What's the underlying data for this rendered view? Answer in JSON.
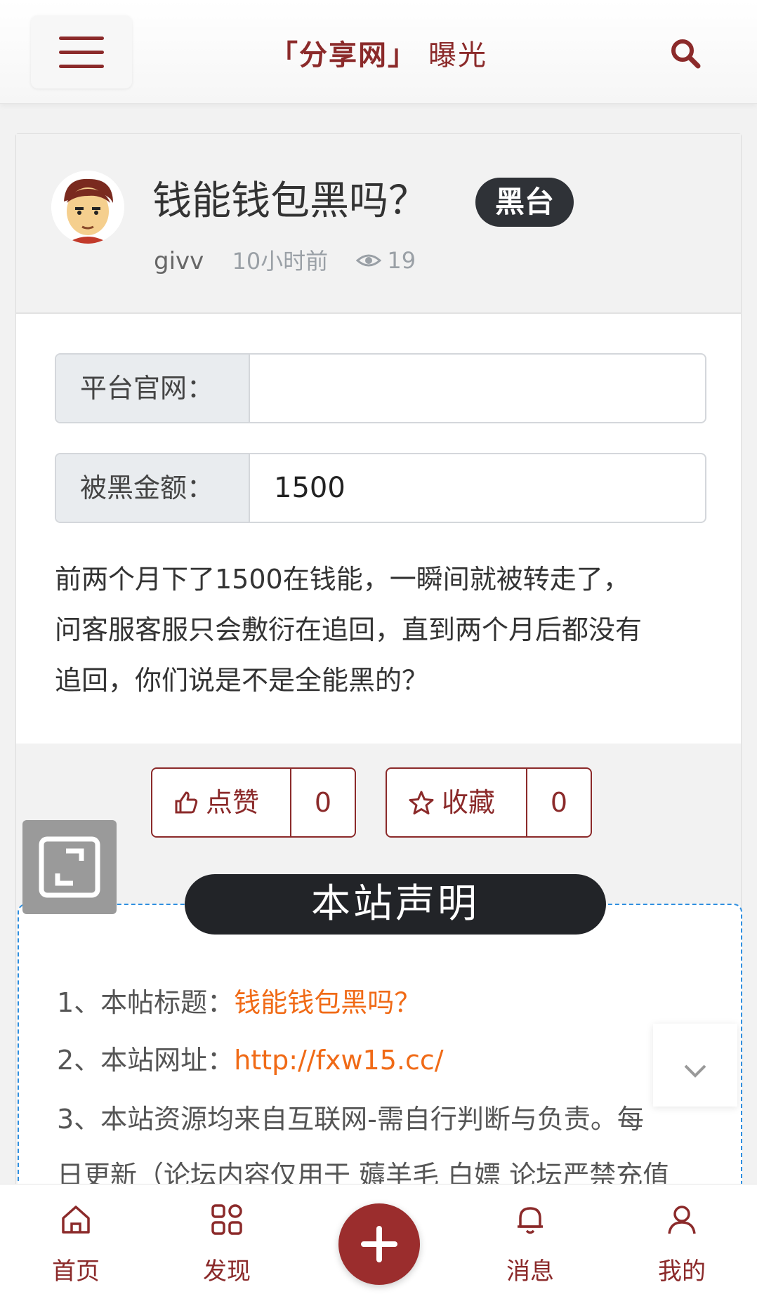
{
  "header": {
    "brand": "「分享网」",
    "subtitle": "曝光"
  },
  "post": {
    "title": "钱能钱包黑吗？",
    "tag": "黑台",
    "author": "givv",
    "time": "10小时前",
    "views": "19",
    "fields": [
      {
        "label": "平台官网：",
        "value": ""
      },
      {
        "label": "被黑金额：",
        "value": "1500"
      }
    ],
    "content_lines": [
      "前两个月下了1500在钱能，一瞬间就被转走了，",
      "问客服客服只会敷衍在追回，直到两个月后都没有",
      "追回，你们说是不是全能黑的？"
    ]
  },
  "actions": {
    "like_label": "点赞",
    "like_count": "0",
    "fav_label": "收藏",
    "fav_count": "0"
  },
  "notice": {
    "title": "本站声明",
    "line1_prefix": "1、本帖标题：",
    "line1_value": "钱能钱包黑吗？",
    "line2_prefix": "2、本站网址：",
    "line2_value": "http://fxw15.cc/",
    "line3": "3、本站资源均来自互联网-需自行判断与负责。每",
    "line4": "日更新（论坛内容仅用于 薅羊毛 白嫖 论坛严禁充值"
  },
  "nav": {
    "items": [
      {
        "label": "首页",
        "icon": "home-icon"
      },
      {
        "label": "发现",
        "icon": "grid-icon"
      },
      {
        "label": "消息",
        "icon": "bell-icon"
      },
      {
        "label": "我的",
        "icon": "user-icon"
      }
    ]
  },
  "colors": {
    "brand": "#8b2a2a",
    "highlight": "#f06a16",
    "dark_badge": "#2f3237",
    "dashed_border": "#2f8fe0"
  }
}
